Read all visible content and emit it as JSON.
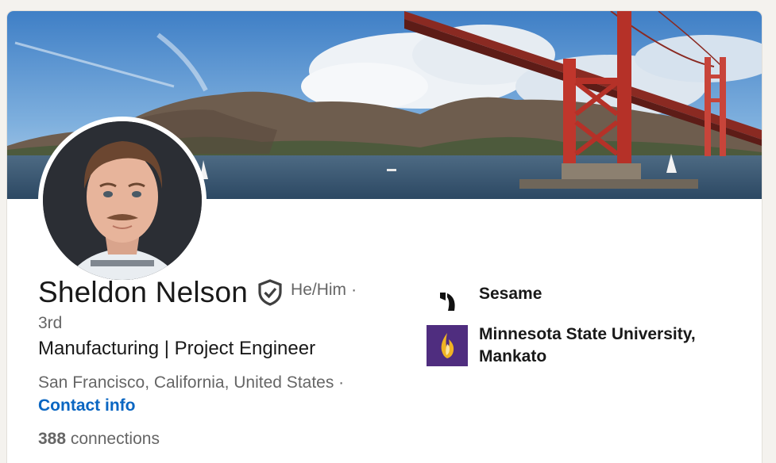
{
  "profile": {
    "name": "Sheldon Nelson",
    "pronouns": "He/Him",
    "separator": "·",
    "degree": "3rd",
    "headline": "Manufacturing | Project Engineer",
    "location": "San Francisco, California, United States ·",
    "contact_info": "Contact info",
    "connections_count": "388",
    "connections_label": " connections"
  },
  "experience": {
    "company": "Sesame",
    "company_icon": "sesame-logo",
    "school": "Minnesota State University, Mankato",
    "school_icon": "minnesota-state-flame-logo"
  },
  "colors": {
    "link": "#0a66c2",
    "school_brand": "#4f2d7f",
    "school_flame": "#f0b323",
    "bridge": "#c0362c"
  },
  "banner": {
    "description_icon": "golden-gate-bridge-photo"
  }
}
